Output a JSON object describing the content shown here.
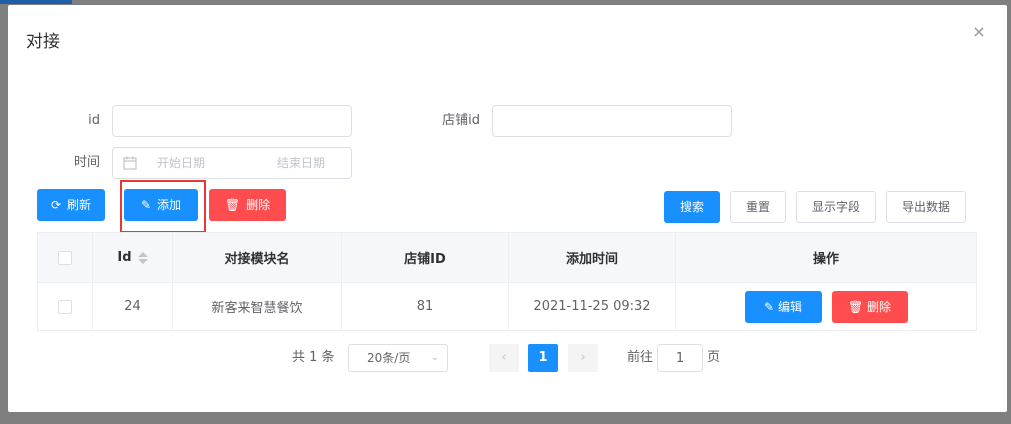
{
  "dialog": {
    "title": "对接",
    "close_glyph": "×"
  },
  "form": {
    "id_label": "id",
    "id_value": "",
    "store_label": "店铺id",
    "store_value": "",
    "time_label": "时间",
    "start_placeholder": "开始日期",
    "end_placeholder": "结束日期"
  },
  "toolbar": {
    "refresh": "刷新",
    "add": "添加",
    "delete": "删除",
    "search": "搜索",
    "reset": "重置",
    "columns": "显示字段",
    "export": "导出数据"
  },
  "table": {
    "headers": [
      "Id",
      "对接模块名",
      "店铺ID",
      "添加时间",
      "操作"
    ],
    "rows": [
      {
        "id": "24",
        "module": "新客来智慧餐饮",
        "store_id": "81",
        "added": "2021-11-25 09:32",
        "edit": "编辑",
        "delete": "删除"
      }
    ]
  },
  "pagination": {
    "total": "共 1 条",
    "page_size": "20条/页",
    "current": "1",
    "goto_label": "前往",
    "goto_value": "1",
    "page_suffix": "页",
    "prev": "‹",
    "next": "›"
  },
  "colors": {
    "primary": "#1890ff",
    "danger": "#ff4d4f",
    "highlight": "#e53935"
  }
}
